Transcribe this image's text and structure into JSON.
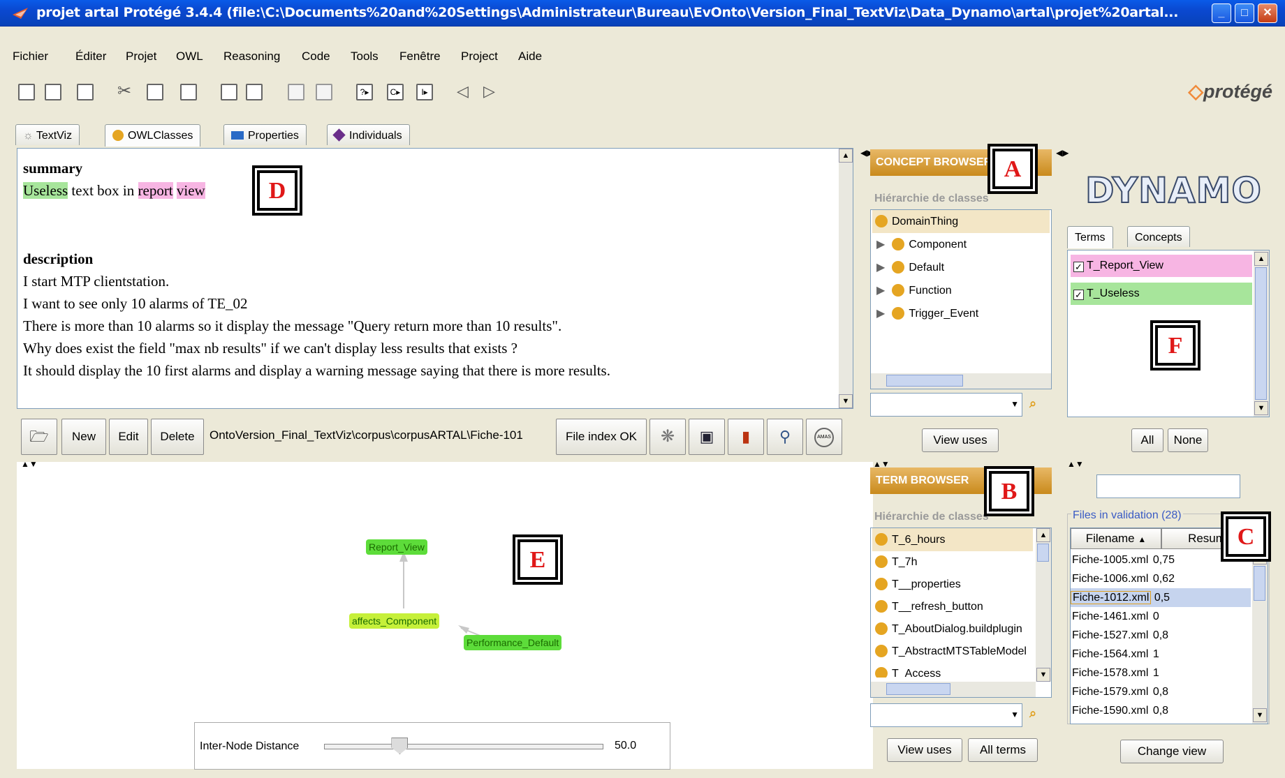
{
  "window": {
    "title": "projet artal  Protégé 3.4.4     (file:\\C:\\Documents%20and%20Settings\\Administrateur\\Bureau\\EvOnto\\Version_Final_TextViz\\Data_Dynamo\\artal\\projet%20artal..."
  },
  "menu": [
    "Fichier",
    "Éditer",
    "Projet",
    "OWL",
    "Reasoning",
    "Code",
    "Tools",
    "Fenêtre",
    "Project",
    "Aide"
  ],
  "logo": "protégé",
  "tabs": [
    "TextViz",
    "OWLClasses",
    "Properties",
    "Individuals"
  ],
  "doc": {
    "summary_heading": "summary",
    "summary_word1": "Useless",
    "summary_mid": " text box in ",
    "summary_word2": "report",
    "summary_word3": "view",
    "description_heading": "description",
    "lines": [
      "I start MTP clientstation.",
      "I want to see only 10 alarms of TE_02",
      "There is more than 10 alarms so it display the message \"Query return more than 10 results\".",
      "Why does exist the field \"max nb results\" if we can't display less results that exists ?",
      "It should display the 10 first alarms and display a warning message saying that there is more results."
    ]
  },
  "docbar": {
    "new": "New",
    "edit": "Edit",
    "delete": "Delete",
    "path": "OntoVersion_Final_TextViz\\corpus\\corpusARTAL\\Fiche-101",
    "file_index": "File index OK"
  },
  "graph": {
    "nodes": [
      "Report_View",
      "affects_Component",
      "Performance_Default"
    ],
    "slider_label": "Inter-Node Distance",
    "slider_value": "50.0",
    "slider_level": 0.27
  },
  "concept_browser": {
    "title": "CONCEPT BROWSER",
    "subtitle": "Hiérarchie de classes",
    "root": "DomainThing",
    "children": [
      "Component",
      "Default",
      "Function",
      "Trigger_Event"
    ],
    "view_uses": "View uses"
  },
  "term_browser": {
    "title": "TERM BROWSER",
    "subtitle": "Hiérarchie de classes",
    "items": [
      "T_6_hours",
      "T_7h",
      "T__properties",
      "T__refresh_button",
      "T_AboutDialog.buildplugin",
      "T_AbstractMTSTableModel",
      "T_Access"
    ],
    "view_uses": "View uses",
    "all_terms": "All terms"
  },
  "dynamo": {
    "logo": "DYNAMO",
    "tabs": [
      "Terms",
      "Concepts"
    ],
    "terms": [
      "T_Report_View",
      "T_Useless"
    ],
    "all": "All",
    "none": "None"
  },
  "files": {
    "title": "Files in validation (28)",
    "col_filename": "Filename",
    "col_result": "Resum",
    "rows": [
      [
        "Fiche-1005.xml",
        "0,75"
      ],
      [
        "Fiche-1006.xml",
        "0,62"
      ],
      [
        "Fiche-1012.xml",
        "0,5"
      ],
      [
        "Fiche-1461.xml",
        "0"
      ],
      [
        "Fiche-1527.xml",
        "0,8"
      ],
      [
        "Fiche-1564.xml",
        "1"
      ],
      [
        "Fiche-1578.xml",
        "1"
      ],
      [
        "Fiche-1579.xml",
        "0,8"
      ],
      [
        "Fiche-1590.xml",
        "0,8"
      ]
    ],
    "change_view": "Change view"
  },
  "callouts": [
    "A",
    "B",
    "C",
    "D",
    "E",
    "F"
  ]
}
